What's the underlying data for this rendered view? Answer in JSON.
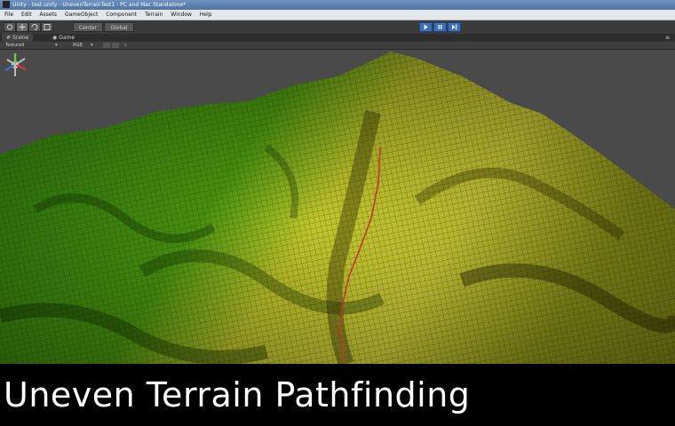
{
  "window": {
    "title": "Unity - test.unity - UnevenTerrainTest1 - PC and Mac Standalone*"
  },
  "menu": [
    "File",
    "Edit",
    "Assets",
    "GameObject",
    "Component",
    "Terrain",
    "Window",
    "Help"
  ],
  "toolbar": {
    "tools": [
      "hand-icon",
      "move-icon",
      "rotate-icon",
      "scale-icon"
    ],
    "pivot_label": "Center",
    "space_label": "Global",
    "play_icons": [
      "play-icon",
      "pause-icon",
      "step-icon"
    ]
  },
  "tabs": [
    {
      "label": "Scene",
      "active": true
    },
    {
      "label": "Game",
      "active": false
    }
  ],
  "scene_toolbar": {
    "render_mode": "Textured",
    "color_mode": "RGB"
  },
  "colors": {
    "play_accent": "#3c6fb7",
    "terrain_green": "#3f9a12",
    "terrain_yellow": "#d8d43a",
    "path_red": "#c0392b"
  },
  "caption": "Uneven Terrain Pathfinding"
}
